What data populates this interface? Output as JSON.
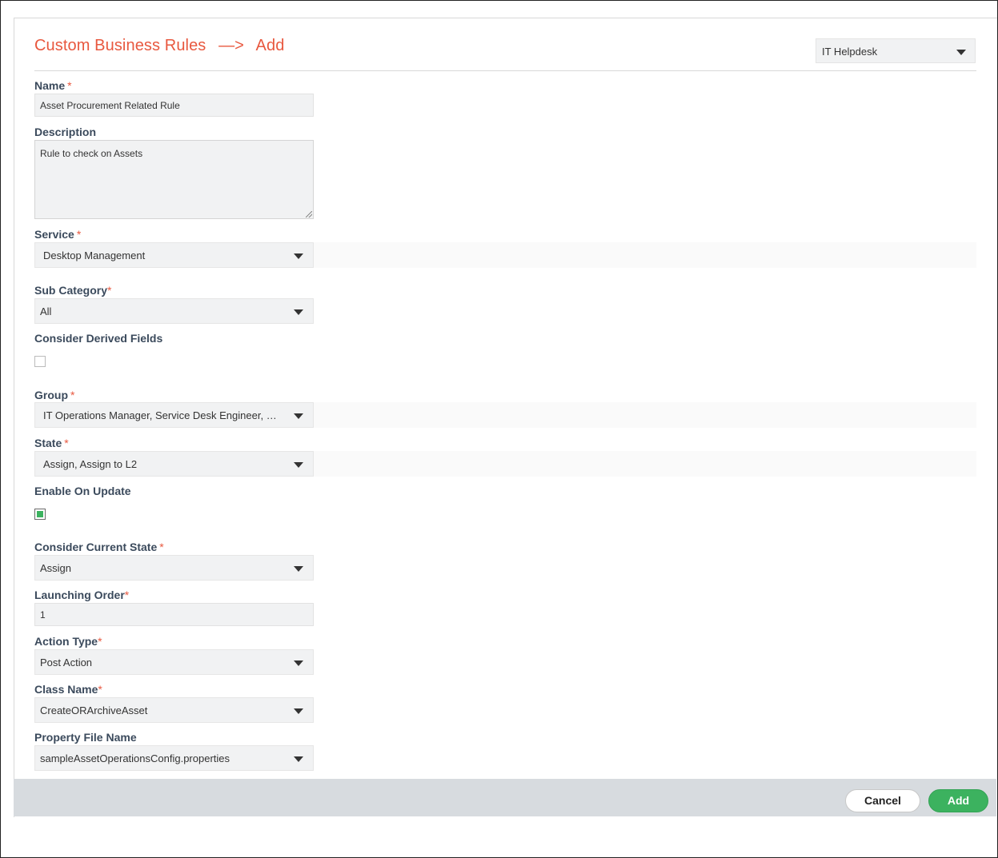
{
  "header": {
    "title_main": "Custom Business Rules",
    "title_arrow": "—>",
    "title_action": "Add",
    "portal": "IT Helpdesk"
  },
  "form": {
    "name": {
      "label": "Name",
      "required_mark": "*",
      "value": "Asset Procurement Related Rule"
    },
    "description": {
      "label": "Description",
      "value": "Rule to check on Assets"
    },
    "service": {
      "label": "Service",
      "required_mark": "*",
      "value": "Desktop Management"
    },
    "sub_category": {
      "label": "Sub Category",
      "required_mark": "*",
      "value": "All"
    },
    "consider_derived_fields": {
      "label": "Consider Derived Fields",
      "checked": false
    },
    "group": {
      "label": "Group",
      "required_mark": "*",
      "value": "IT Operations Manager, Service Desk Engineer, Se..."
    },
    "state": {
      "label": "State",
      "required_mark": "*",
      "value": "Assign, Assign to L2"
    },
    "enable_on_update": {
      "label": "Enable On Update",
      "checked": true
    },
    "consider_current_state": {
      "label": "Consider Current State",
      "required_mark": "*",
      "value": "Assign"
    },
    "launching_order": {
      "label": "Launching Order",
      "required_mark": "*",
      "value": "1"
    },
    "action_type": {
      "label": "Action Type",
      "required_mark": "*",
      "value": "Post Action"
    },
    "class_name": {
      "label": "Class Name",
      "required_mark": "*",
      "value": "CreateORArchiveAsset"
    },
    "property_file_name": {
      "label": "Property File Name",
      "value": "sampleAssetOperationsConfig.properties"
    }
  },
  "footer": {
    "cancel_label": "Cancel",
    "add_label": "Add"
  },
  "colors": {
    "title": "#e8583f",
    "required": "#e8583f",
    "primary": "#3cb25f",
    "footer_bg": "#d7dbdf",
    "field_bg": "#f1f2f3"
  },
  "icons": {
    "dropdown": "chevron-down-icon",
    "resize": "resize-grip-icon"
  }
}
